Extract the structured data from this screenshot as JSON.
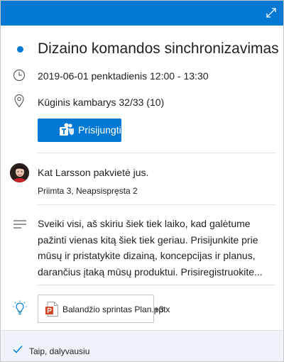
{
  "header": {
    "accent_color": "#0078d4",
    "expand_icon": "expand-diagonal-icon"
  },
  "event": {
    "title": "Dizaino komandos sinchronizavimas",
    "datetime": "2019-06-01 penktadienis 12:00 - 13:30",
    "location": "Kūginis kambarys 32/33 (10)",
    "join_label": "Prisijungti"
  },
  "organizer": {
    "invite_text": "Kat Larsson pakvietė jus.",
    "responses": "Priimta 3, Neapsispręsta 2"
  },
  "notes": {
    "lines": [
      "Sveiki visi, aš skiriu šiek tiek laiko, kad galėtume",
      "pažinti vienas kitą šiek tiek geriau. Prisijunkite prie",
      "mūsų ir pristatykite dizainą, koncepcijas ir planus,",
      "darančius įtaką mūsų produktui. Prisiregistruokite..."
    ]
  },
  "attachments": {
    "file_name": "Balandžio sprintas Plan.pptx",
    "more": "+3"
  },
  "footer": {
    "response_label": "Taip, dalyvausiu"
  }
}
